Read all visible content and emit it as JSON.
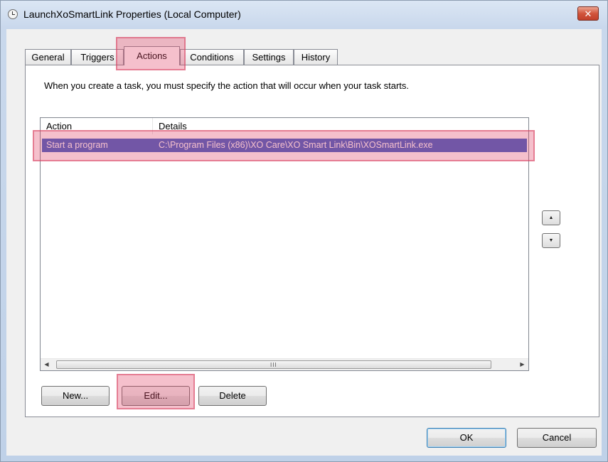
{
  "window": {
    "title": "LaunchXoSmartLink Properties (Local Computer)",
    "close_label": "✕"
  },
  "tabs": [
    {
      "label": "General",
      "active": false
    },
    {
      "label": "Triggers",
      "active": false
    },
    {
      "label": "Actions",
      "active": true
    },
    {
      "label": "Conditions",
      "active": false
    },
    {
      "label": "Settings",
      "active": false
    },
    {
      "label": "History",
      "active": false
    }
  ],
  "actions_tab": {
    "description": "When you create a task, you must specify the action that will occur when your task starts.",
    "columns": [
      "Action",
      "Details"
    ],
    "rows": [
      {
        "action": "Start a program",
        "details": "C:\\Program Files (x86)\\XO Care\\XO Smart Link\\Bin\\XOSmartLink.exe",
        "selected": true
      }
    ],
    "move_up_icon": "▲",
    "move_down_icon": "▼",
    "scroll_left_icon": "◀",
    "scroll_right_icon": "▶",
    "scroll_grip": "III",
    "buttons": {
      "new": "New...",
      "edit": "Edit...",
      "delete": "Delete"
    }
  },
  "dialog_buttons": {
    "ok": "OK",
    "cancel": "Cancel"
  },
  "colors": {
    "selection": "#3f63c8",
    "highlight_overlay": "#e13c5f"
  }
}
